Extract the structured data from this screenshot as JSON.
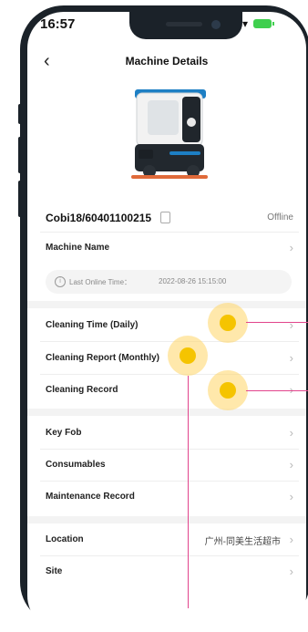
{
  "status_bar": {
    "time": "16:57"
  },
  "header": {
    "title": "Machine Details"
  },
  "machine": {
    "serial": "Cobi18/60401100215",
    "status": "Offline",
    "name_label": "Machine Name",
    "last_online_label": "Last Online Time：",
    "last_online_value": "2022-08-26 15:15:00"
  },
  "cleaning_section": [
    {
      "label": "Cleaning Time (Daily)"
    },
    {
      "label": "Cleaning Report (Monthly)"
    },
    {
      "label": "Cleaning Record"
    }
  ],
  "accessory_section": [
    {
      "label": "Key Fob"
    },
    {
      "label": "Consumables"
    },
    {
      "label": "Maintenance Record"
    }
  ],
  "location_section": {
    "location_label": "Location",
    "location_value": "广州-同美生活超市",
    "site_label": "Site"
  },
  "colors": {
    "touch_indicator": "#f5c400",
    "pointer_line": "#e2448c",
    "frame": "#1b2229"
  }
}
